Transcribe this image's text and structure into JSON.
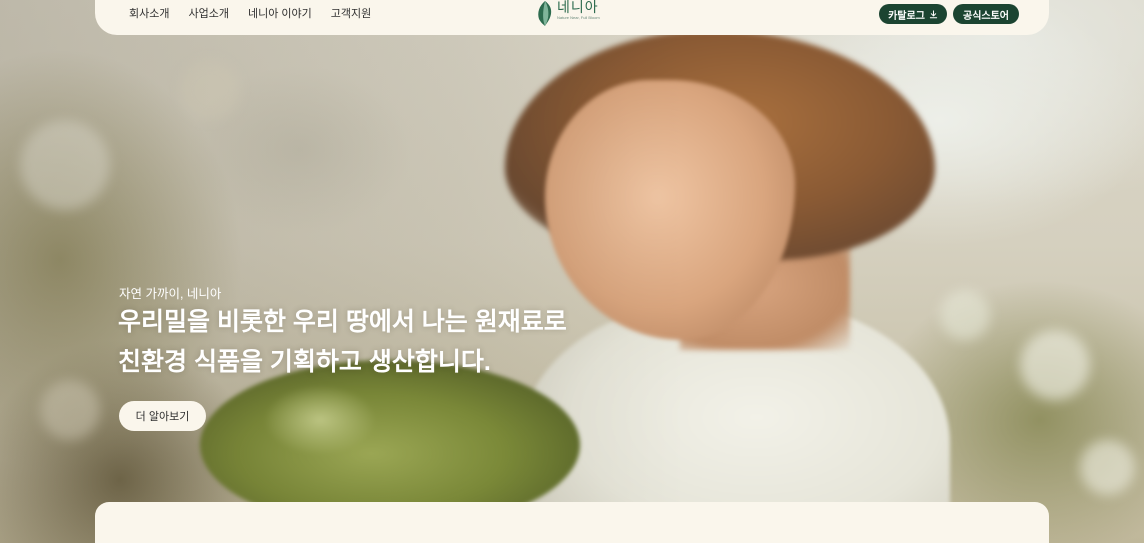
{
  "nav": {
    "links": [
      "회사소개",
      "사업소개",
      "네니아 이야기",
      "고객지원"
    ],
    "logo": {
      "name": "네니아",
      "tagline": "Nature Near, Full Bloom"
    },
    "catalog_label": "카탈로그",
    "store_label": "공식스토어"
  },
  "hero": {
    "eyebrow": "자연 가까이, 네니아",
    "headline_line1": "우리밀을 비롯한 우리 땅에서 나는 원재료로",
    "headline_line2": "친환경 식품을 기획하고 생산합니다.",
    "cta_label": "더 알아보기"
  },
  "colors": {
    "nav_bg": "#faf6ec",
    "brand_green": "#1b4431",
    "logo_green": "#2d6b4e",
    "text_dark": "#2f2f2f",
    "hero_text": "#ffffff"
  },
  "icons": {
    "catalog_button": "download-icon",
    "logo": "leaf-logo-icon"
  }
}
